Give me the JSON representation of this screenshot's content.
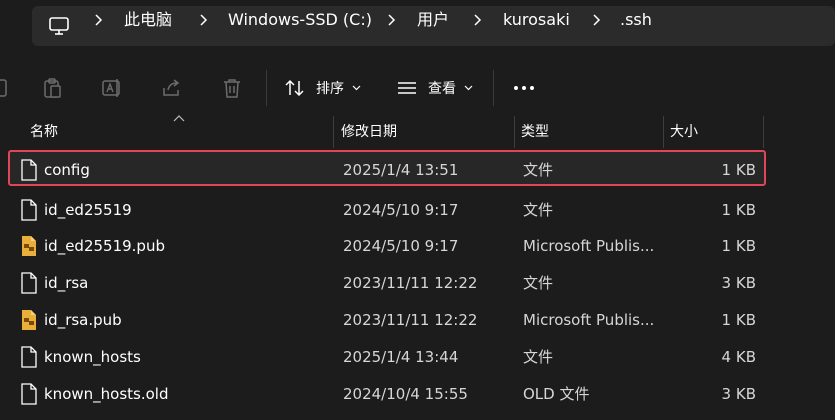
{
  "breadcrumb": {
    "items": [
      {
        "label": "此电脑"
      },
      {
        "label": "Windows-SSD (C:)"
      },
      {
        "label": "用户"
      },
      {
        "label": "kurosaki"
      },
      {
        "label": ".ssh"
      }
    ]
  },
  "toolbar": {
    "sort_label": "排序",
    "view_label": "查看"
  },
  "columns": {
    "name": "名称",
    "date": "修改日期",
    "type": "类型",
    "size": "大小"
  },
  "files": [
    {
      "name": "config",
      "date": "2025/1/4 13:51",
      "type": "文件",
      "size": "1 KB",
      "icon": "file-icon",
      "selected": true
    },
    {
      "name": "id_ed25519",
      "date": "2024/5/10 9:17",
      "type": "文件",
      "size": "1 KB",
      "icon": "file-icon"
    },
    {
      "name": "id_ed25519.pub",
      "date": "2024/5/10 9:17",
      "type": "Microsoft Publis...",
      "size": "1 KB",
      "icon": "publisher-file-icon"
    },
    {
      "name": "id_rsa",
      "date": "2023/11/11 12:22",
      "type": "文件",
      "size": "3 KB",
      "icon": "file-icon"
    },
    {
      "name": "id_rsa.pub",
      "date": "2023/11/11 12:22",
      "type": "Microsoft Publis...",
      "size": "1 KB",
      "icon": "publisher-file-icon"
    },
    {
      "name": "known_hosts",
      "date": "2025/1/4 13:44",
      "type": "文件",
      "size": "4 KB",
      "icon": "file-icon"
    },
    {
      "name": "known_hosts.old",
      "date": "2024/10/4 15:55",
      "type": "OLD 文件",
      "size": "3 KB",
      "icon": "file-icon"
    }
  ],
  "colors": {
    "background": "#1c1c1c",
    "selection_outline": "#e0455a",
    "publisher_icon": "#e8b03a"
  }
}
